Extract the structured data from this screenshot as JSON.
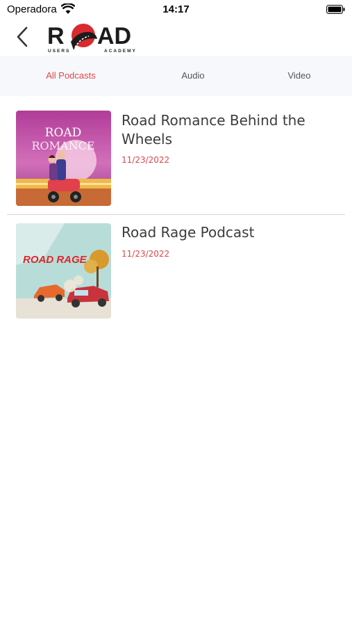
{
  "status_bar": {
    "carrier": "Operadora",
    "time": "14:17",
    "icons": [
      "wifi-icon",
      "battery-icon"
    ]
  },
  "header": {
    "back_icon": "chevron-left-icon",
    "logo": {
      "wordmark": "ROAD",
      "tagline_left": "USERS",
      "tagline_right": "ACADEMY",
      "accent_color": "#d92a2f"
    }
  },
  "tabs": [
    {
      "label": "All Podcasts",
      "active": true
    },
    {
      "label": "Audio",
      "active": false
    },
    {
      "label": "Video",
      "active": false
    }
  ],
  "podcasts": [
    {
      "title": "Road Romance Behind the Wheels",
      "date": "11/23/2022",
      "thumbnail_text_line1": "ROAD",
      "thumbnail_text_line2": "ROMANCE"
    },
    {
      "title": "Road Rage Podcast",
      "date": "11/23/2022",
      "thumbnail_text": "ROAD RAGE"
    }
  ],
  "colors": {
    "accent": "#e0464b",
    "tab_background": "#f6f8fb",
    "text": "#3c3c3c"
  }
}
